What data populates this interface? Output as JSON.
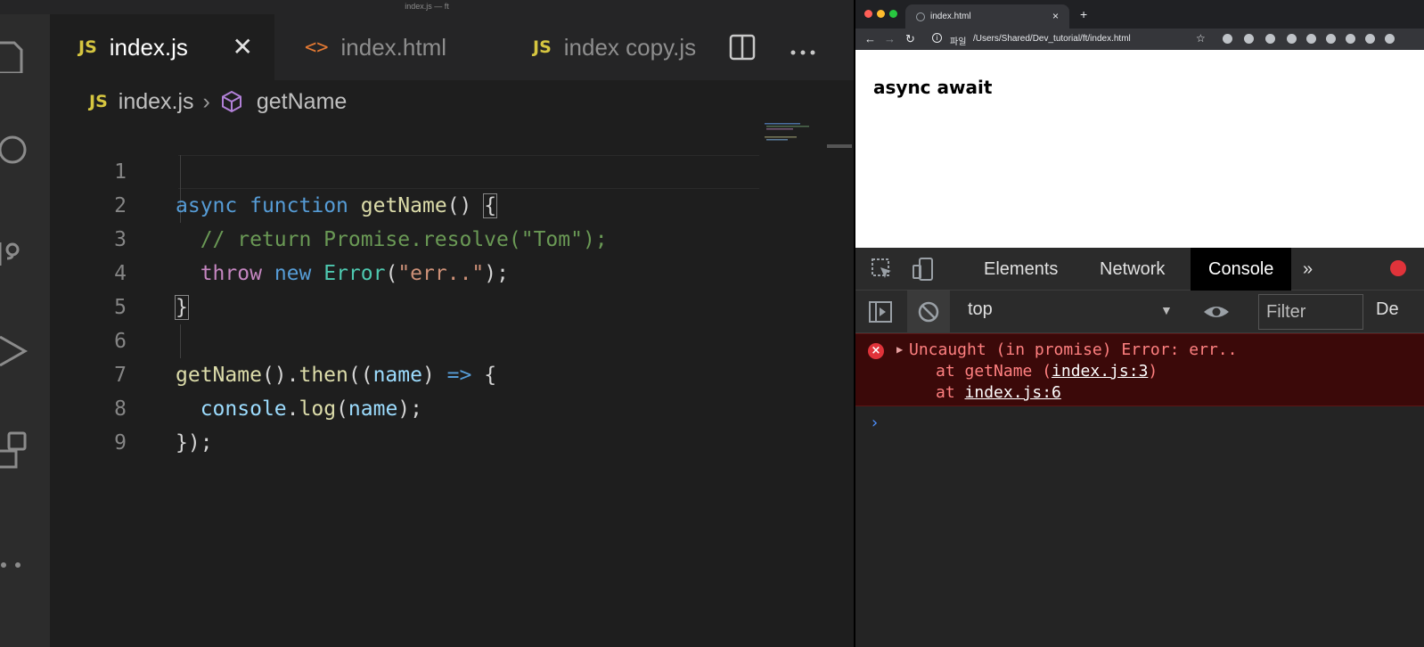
{
  "vscode": {
    "window_title": "index.js — ft",
    "tabs": [
      {
        "badge": "JS",
        "label": "index.js",
        "active": true
      },
      {
        "badge": "<>",
        "label": "index.html",
        "active": false
      },
      {
        "badge": "JS",
        "label": "index copy.js",
        "active": false
      }
    ],
    "breadcrumb": {
      "badge": "JS",
      "file": "index.js",
      "symbol": "getName"
    },
    "line_numbers": [
      "1",
      "2",
      "3",
      "4",
      "5",
      "6",
      "7",
      "8",
      "9"
    ]
  },
  "browser": {
    "tab_title": "index.html",
    "scheme_label": "파일",
    "url": "/Users/Shared/Dev_tutorial/ft/index.html",
    "page_heading": "async await",
    "devtools": {
      "tabs": [
        "Elements",
        "Network",
        "Console"
      ],
      "more": "»",
      "context": "top",
      "filter_placeholder": "Filter",
      "levels_label": "De",
      "error": {
        "message": "Uncaught (in promise) Error: err..",
        "stack1_prefix": "at getName (",
        "stack1_link": "index.js:3",
        "stack1_suffix": ")",
        "stack2_prefix": "at ",
        "stack2_link": "index.js:6"
      },
      "prompt": "›"
    }
  },
  "colors": {
    "keyword": "#569cd6",
    "function": "#dcdcaa",
    "comment": "#6a9955",
    "control": "#c586c0",
    "type": "#4ec9b0",
    "string": "#ce9178",
    "console_error_bg": "#3b0909"
  }
}
